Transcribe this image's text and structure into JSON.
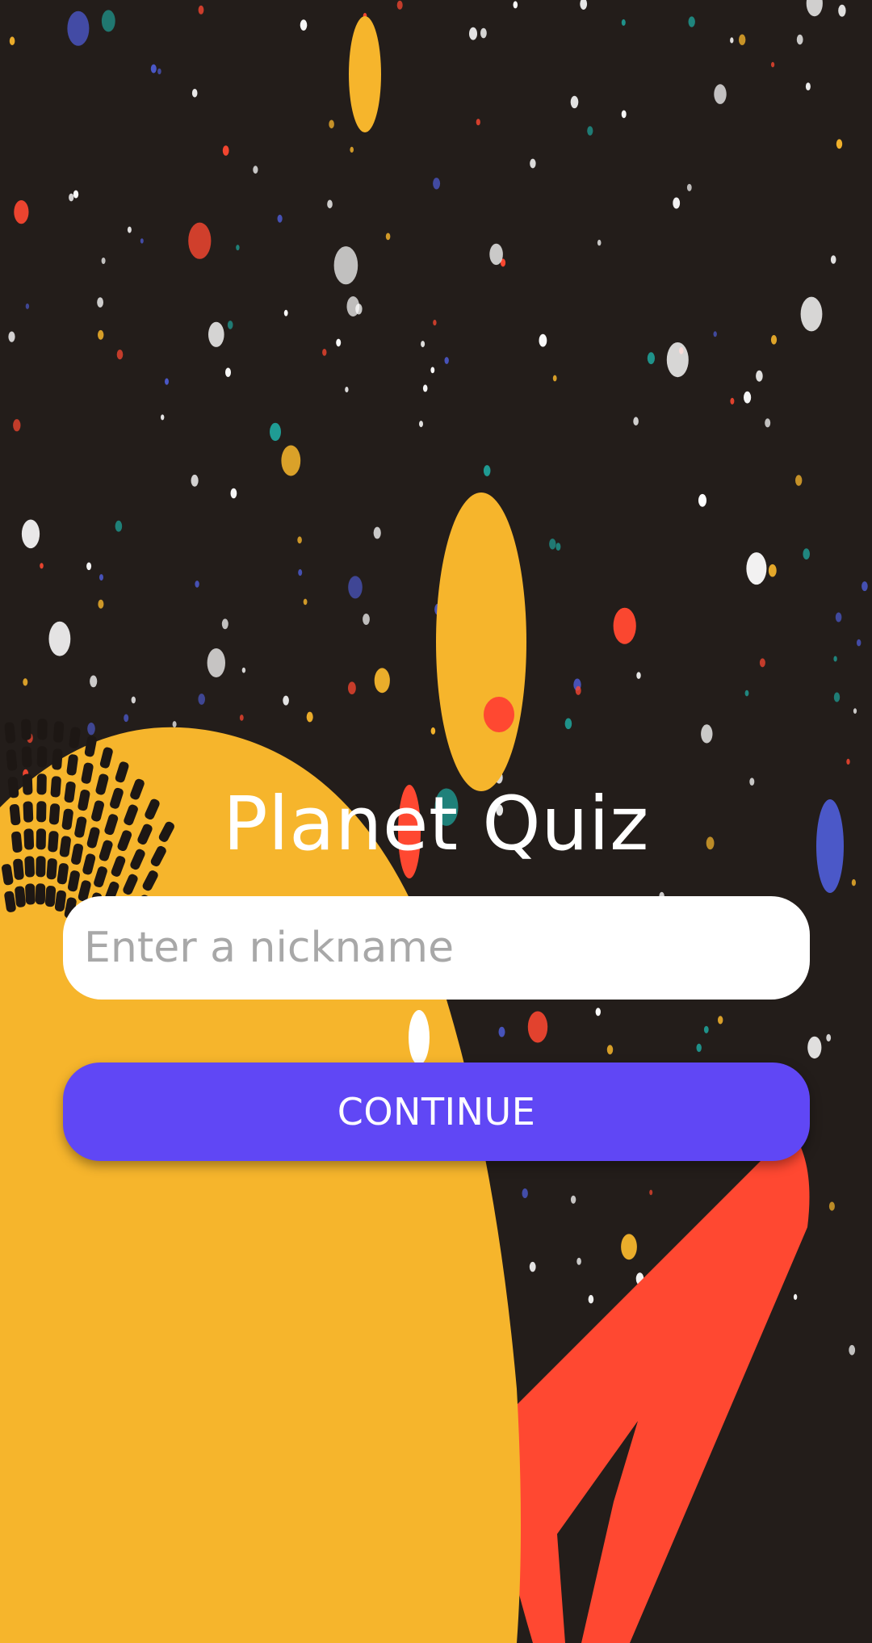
{
  "app": {
    "title": "Planet Quiz"
  },
  "form": {
    "nickname_value": "",
    "nickname_placeholder": "Enter a nickname",
    "continue_label": "CONTINUE"
  },
  "colors": {
    "background": "#231d1a",
    "planet_yellow": "#f6b52c",
    "ring_red": "#ff4831",
    "button_accent": "#6047f5",
    "input_background": "#ffffff",
    "title_text": "#ffffff"
  },
  "icons": {
    "background_art": "space-illustration"
  }
}
